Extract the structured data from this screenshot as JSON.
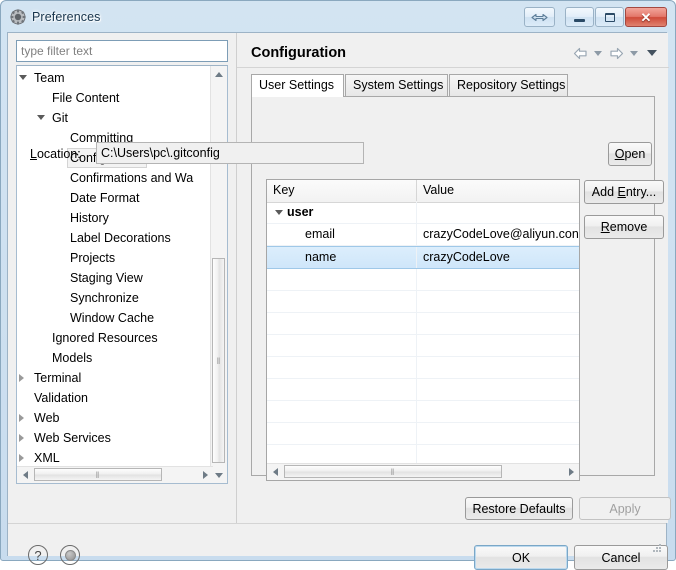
{
  "window": {
    "title": "Preferences",
    "icon": "gear-icon",
    "controls": {
      "help": "help-resize-icon",
      "minimize": "minimize-icon",
      "maximize": "maximize-icon",
      "close": "✕"
    }
  },
  "sidebar": {
    "filter": {
      "placeholder": "type filter text",
      "value": ""
    },
    "items": [
      {
        "label": "Team",
        "indent": 0,
        "arrow": "expanded",
        "selected": false
      },
      {
        "label": "File Content",
        "indent": 1,
        "arrow": "none",
        "selected": false
      },
      {
        "label": "Git",
        "indent": 1,
        "arrow": "expanded",
        "selected": false
      },
      {
        "label": "Committing",
        "indent": 2,
        "arrow": "none",
        "selected": false
      },
      {
        "label": "Configuration",
        "indent": 2,
        "arrow": "none",
        "selected": true
      },
      {
        "label": "Confirmations and Wa",
        "indent": 2,
        "arrow": "none",
        "selected": false
      },
      {
        "label": "Date Format",
        "indent": 2,
        "arrow": "none",
        "selected": false
      },
      {
        "label": "History",
        "indent": 2,
        "arrow": "none",
        "selected": false
      },
      {
        "label": "Label Decorations",
        "indent": 2,
        "arrow": "none",
        "selected": false
      },
      {
        "label": "Projects",
        "indent": 2,
        "arrow": "none",
        "selected": false
      },
      {
        "label": "Staging View",
        "indent": 2,
        "arrow": "none",
        "selected": false
      },
      {
        "label": "Synchronize",
        "indent": 2,
        "arrow": "none",
        "selected": false
      },
      {
        "label": "Window Cache",
        "indent": 2,
        "arrow": "none",
        "selected": false
      },
      {
        "label": "Ignored Resources",
        "indent": 1,
        "arrow": "none",
        "selected": false
      },
      {
        "label": "Models",
        "indent": 1,
        "arrow": "none",
        "selected": false
      },
      {
        "label": "Terminal",
        "indent": 0,
        "arrow": "collapsed",
        "selected": false
      },
      {
        "label": "Validation",
        "indent": 0,
        "arrow": "none",
        "selected": false
      },
      {
        "label": "Web",
        "indent": 0,
        "arrow": "collapsed",
        "selected": false
      },
      {
        "label": "Web Services",
        "indent": 0,
        "arrow": "collapsed",
        "selected": false
      },
      {
        "label": "XML",
        "indent": 0,
        "arrow": "collapsed",
        "selected": false
      }
    ],
    "scrollbar": {
      "grip": "‖"
    }
  },
  "main": {
    "title": "Configuration",
    "nav": {
      "back": "back-arrow-icon",
      "back_menu": "chevron-down-icon",
      "forward": "forward-arrow-icon",
      "forward_menu": "chevron-down-icon",
      "view_menu": "chevron-down-icon"
    },
    "tabs": [
      {
        "label": "User Settings",
        "active": true
      },
      {
        "label": "System Settings",
        "active": false
      },
      {
        "label": "Repository Settings",
        "active": false
      }
    ],
    "location": {
      "label": "Location:",
      "label_mnemonic": "L",
      "value": "C:\\Users\\pc\\.gitconfig",
      "placeholder": ""
    },
    "buttons": {
      "open": {
        "pre": "",
        "mnemonic": "O",
        "post": "pen",
        "disabled": false
      },
      "add": {
        "pre": "Add ",
        "mnemonic": "E",
        "post": "ntry...",
        "disabled": false
      },
      "remove": {
        "pre": "",
        "mnemonic": "R",
        "post": "emove",
        "disabled": false
      }
    },
    "table": {
      "columns": [
        "Key",
        "Value"
      ],
      "rows": [
        {
          "key": "user",
          "value": "",
          "type": "group",
          "selected": false,
          "arrow": "expanded"
        },
        {
          "key": "email",
          "value": "crazyCodeLove@aliyun.con",
          "type": "child",
          "selected": false,
          "arrow": "none"
        },
        {
          "key": "name",
          "value": "crazyCodeLove",
          "type": "child",
          "selected": true,
          "arrow": "none"
        }
      ],
      "empty_rows": 11,
      "scrollbar": {
        "grip": "‖"
      }
    }
  },
  "footer": {
    "restore_defaults": "Restore Defaults",
    "apply": "Apply",
    "apply_disabled": true,
    "ok": "OK",
    "cancel": "Cancel",
    "help_icon": "?",
    "oomph_icon": "oomph-icon"
  },
  "colors": {
    "selection_blue": "#cfe6fa",
    "accent_border": "#9fc8e8",
    "dialog_bg": "#f0f0f0",
    "titlebar": "#cfe1f1",
    "close_red": "#cf4a39"
  }
}
